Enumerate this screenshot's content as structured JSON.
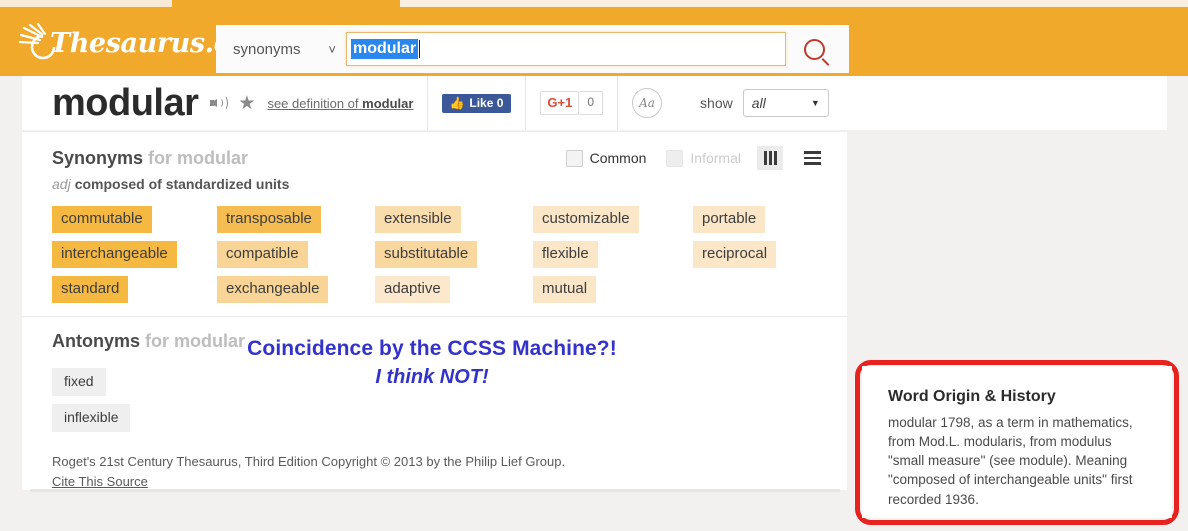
{
  "brand": {
    "logo_text": "Thesaurus.com",
    "logo_icon": "sun-rays-icon"
  },
  "search": {
    "type_label": "synonyms",
    "type_caret_icon": "chevron-down-icon",
    "query_value": "modular",
    "submit_icon": "search-icon"
  },
  "word_header": {
    "word": "modular",
    "audio_icon": "speaker-icon",
    "favorite_icon": "star-icon",
    "definition_link_prefix": "see definition of ",
    "definition_link_word": "modular",
    "facebook_label": "Like 0",
    "facebook_icon": "thumbs-up-icon",
    "gplus_label": "G+1",
    "gplus_count": "0",
    "font_size_icon": "Aa",
    "show_label": "show",
    "show_value": "all",
    "show_caret_icon": "caret-down-icon"
  },
  "synonyms_section": {
    "title": "Synonyms",
    "title_suffix": "for modular",
    "common_label": "Common",
    "informal_label": "Informal",
    "columns_view_icon": "columns-view-icon",
    "list_view_icon": "list-view-icon",
    "pos": "adj",
    "definition": "composed of standardized units",
    "columns": [
      [
        {
          "word": "commutable",
          "bg": "#f5b942"
        },
        {
          "word": "interchangeable",
          "bg": "#f5b942"
        },
        {
          "word": "standard",
          "bg": "#f5b942"
        }
      ],
      [
        {
          "word": "transposable",
          "bg": "#f5bd51"
        },
        {
          "word": "compatible",
          "bg": "#f8d596"
        },
        {
          "word": "exchangeable",
          "bg": "#f8d596"
        }
      ],
      [
        {
          "word": "extensible",
          "bg": "#f9ddad"
        },
        {
          "word": "substitutable",
          "bg": "#f9d8a0"
        },
        {
          "word": "adaptive",
          "bg": "#fbe8cd"
        }
      ],
      [
        {
          "word": "customizable",
          "bg": "#fbe6c8"
        },
        {
          "word": "flexible",
          "bg": "#fbe6c8"
        },
        {
          "word": "mutual",
          "bg": "#fbe6c8"
        }
      ],
      [
        {
          "word": "portable",
          "bg": "#fbe6c8"
        },
        {
          "word": "reciprocal",
          "bg": "#fbe6c8"
        }
      ]
    ]
  },
  "antonyms_section": {
    "title": "Antonyms",
    "title_suffix": "for modular",
    "tags": [
      "fixed",
      "inflexible"
    ]
  },
  "credit": {
    "text": "Roget's 21st Century Thesaurus, Third Edition Copyright © 2013 by the Philip Lief Group.",
    "cite_link": "Cite This Source"
  },
  "overlay_annotation": {
    "line1": "Coincidence by the CCSS Machine?!",
    "line2": "I think NOT!",
    "color": "#3333cc"
  },
  "word_origin": {
    "title": "Word Origin & History",
    "body": "modular 1798, as a term in mathematics, from Mod.L. modularis, from modulus \"small measure\" (see module). Meaning \"composed of interchangeable units\" first recorded 1936.",
    "highlight_color": "#e8221e"
  },
  "colors": {
    "brand_orange": "#f0a92a",
    "page_background": "#f2f1f0",
    "selection_blue": "#2b87f0",
    "facebook_blue": "#3b5998",
    "gplus_red": "#dd4b39"
  }
}
